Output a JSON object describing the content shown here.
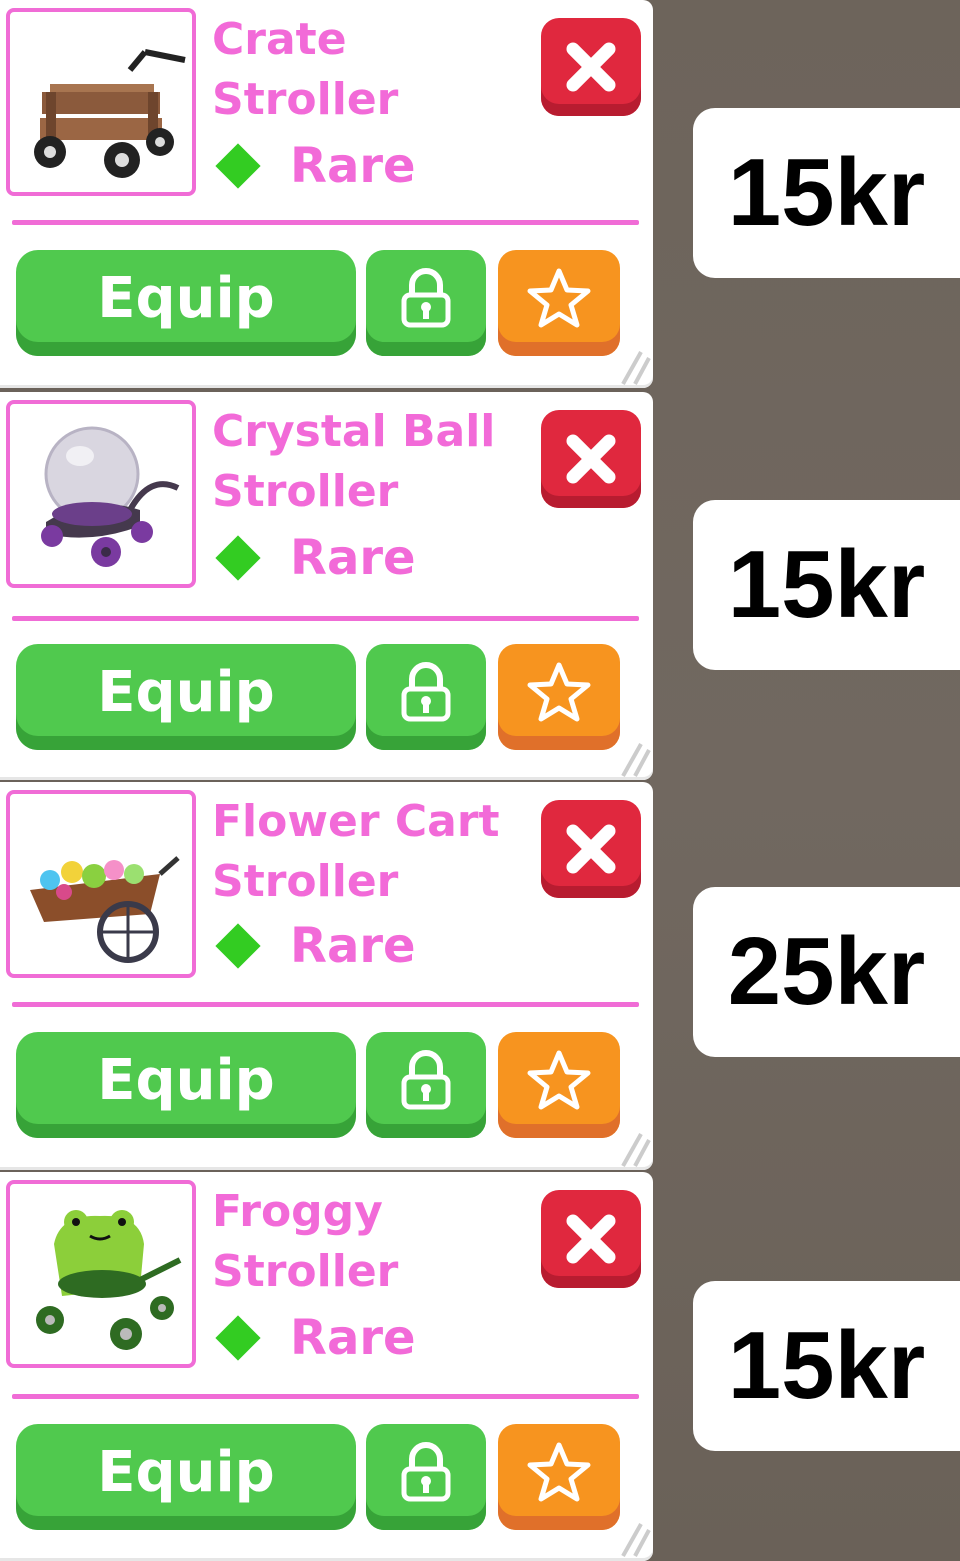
{
  "items": [
    {
      "name": "Crate Stroller",
      "rarity": "Rare",
      "equip_label": "Equip",
      "price": "15kr",
      "image_icon": "crate-stroller-icon"
    },
    {
      "name": "Crystal Ball Stroller",
      "rarity": "Rare",
      "equip_label": "Equip",
      "price": "15kr",
      "image_icon": "crystal-ball-stroller-icon"
    },
    {
      "name": "Flower Cart Stroller",
      "rarity": "Rare",
      "equip_label": "Equip",
      "price": "25kr",
      "image_icon": "flower-cart-stroller-icon"
    },
    {
      "name": "Froggy Stroller",
      "rarity": "Rare",
      "equip_label": "Equip",
      "price": "15kr",
      "image_icon": "froggy-stroller-icon"
    }
  ],
  "colors": {
    "accent_pink": "#f26ad8",
    "rarity_green": "#33cc22",
    "equip_green": "#50c94e",
    "close_red": "#e0283e",
    "favorite_orange": "#f7941f",
    "background": "#6b625a"
  }
}
